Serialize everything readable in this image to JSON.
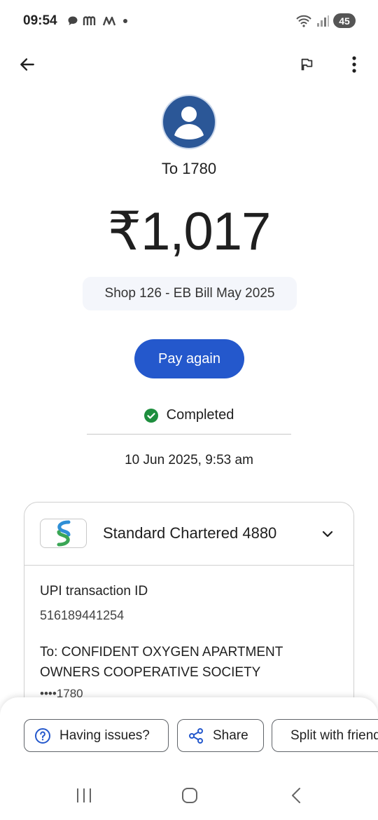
{
  "status_bar": {
    "time": "09:54",
    "battery": "45",
    "icons": [
      "chat-bubble-icon",
      "m-app-icon",
      "m-app-icon",
      "dot-icon",
      "wifi-icon",
      "signal-icon"
    ]
  },
  "header": {
    "back_icon": "arrow-left-icon",
    "flag_icon": "flag-icon",
    "more_icon": "more-vertical-icon"
  },
  "payment": {
    "recipient_label": "To 1780",
    "amount": "₹1,017",
    "note": "Shop 126 - EB Bill May 2025",
    "pay_again_label": "Pay again",
    "status": "Completed",
    "datetime": "10 Jun 2025, 9:53 am"
  },
  "details": {
    "bank_name": "Standard Chartered 4880",
    "upi_label": "UPI transaction ID",
    "upi_id": "516189441254",
    "to_name": "To: CONFIDENT OXYGEN APARTMENT OWNERS COOPERATIVE SOCIETY",
    "account_mask": "••••1780"
  },
  "actions": {
    "having_issues": "Having issues?",
    "share": "Share",
    "split": "Split with friends"
  },
  "colors": {
    "primary": "#2458cc",
    "avatar_bg": "#2b5797",
    "success": "#1e8e3e"
  }
}
